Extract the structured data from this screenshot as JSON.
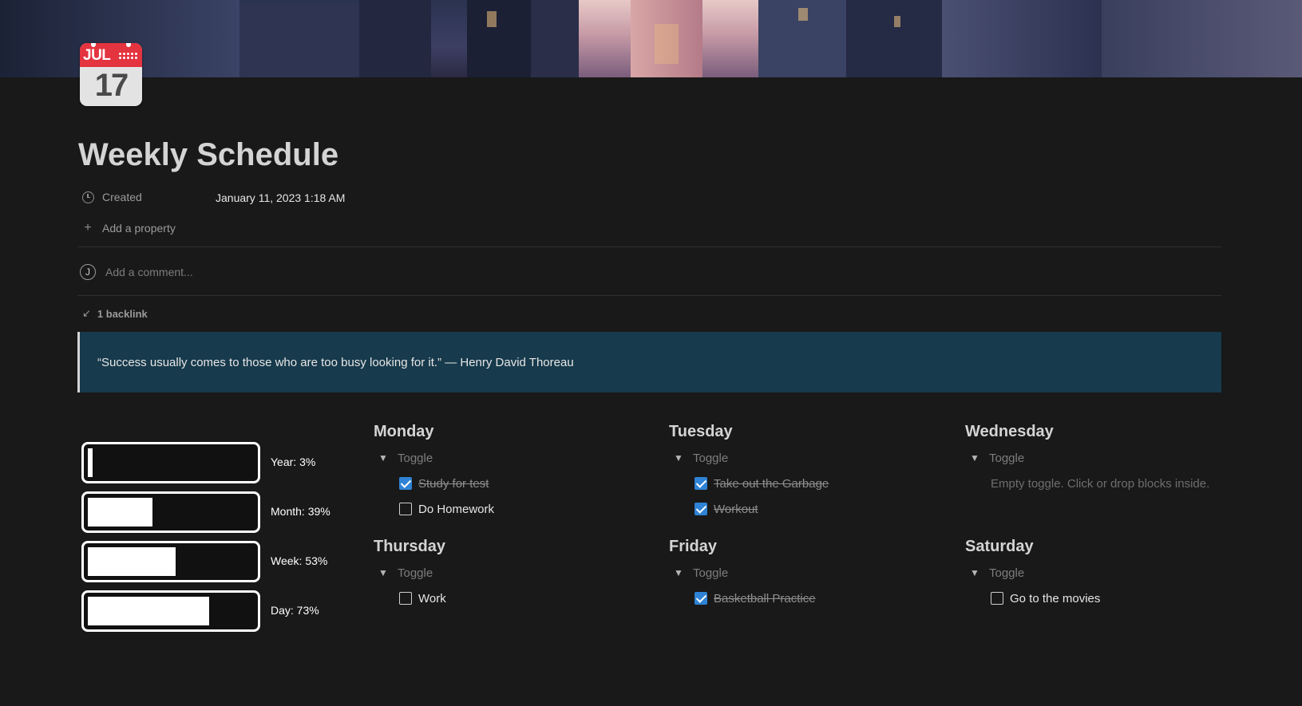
{
  "calendar_icon": {
    "month": "JUL",
    "day": "17"
  },
  "page": {
    "title": "Weekly Schedule"
  },
  "properties": {
    "created_label": "Created",
    "created_value": "January 11, 2023 1:18 AM",
    "add_property": "Add a property"
  },
  "comment": {
    "avatar_letter": "J",
    "placeholder": "Add a comment..."
  },
  "backlink": {
    "label": "1 backlink"
  },
  "quote": {
    "text": "“Success usually comes to those who are too busy looking for it.” — Henry David Thoreau"
  },
  "progress": [
    {
      "label": "Year: 3%",
      "percent": 3
    },
    {
      "label": "Month: 39%",
      "percent": 39
    },
    {
      "label": "Week: 53%",
      "percent": 53
    },
    {
      "label": "Day: 73%",
      "percent": 73
    }
  ],
  "days": [
    {
      "name": "Monday",
      "toggle": "Toggle",
      "todos": [
        {
          "text": "Study for test",
          "checked": true
        },
        {
          "text": "Do Homework",
          "checked": false
        }
      ]
    },
    {
      "name": "Tuesday",
      "toggle": "Toggle",
      "todos": [
        {
          "text": "Take out the Garbage",
          "checked": true
        },
        {
          "text": "Workout",
          "checked": true
        }
      ]
    },
    {
      "name": "Wednesday",
      "toggle": "Toggle",
      "empty": "Empty toggle. Click or drop blocks inside.",
      "todos": []
    },
    {
      "name": "Thursday",
      "toggle": "Toggle",
      "todos": [
        {
          "text": "Work",
          "checked": false
        }
      ]
    },
    {
      "name": "Friday",
      "toggle": "Toggle",
      "todos": [
        {
          "text": "Basketball Practice",
          "checked": true
        }
      ]
    },
    {
      "name": "Saturday",
      "toggle": "Toggle",
      "todos": [
        {
          "text": "Go to the movies",
          "checked": false
        }
      ]
    }
  ],
  "colors": {
    "background": "#191919",
    "quote_bg": "#173a4c",
    "checkbox": "#2f83d6",
    "calendar_red": "#e3343f"
  }
}
